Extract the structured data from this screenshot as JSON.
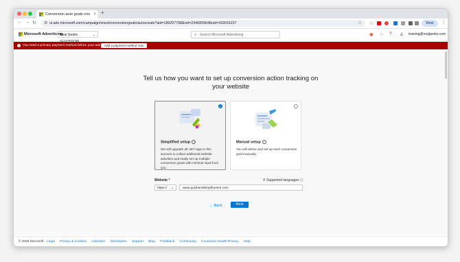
{
  "browser": {
    "tab_title": "Conversion auto goals creati",
    "tab_close": "×",
    "new_tab": "+",
    "url": "ui.ads.microsoft.com/campaign/vnext/conversiongoals/autocreate?aid=189207798&cid=2346839648uid=169016237",
    "profile_label": "Work"
  },
  "app": {
    "brand": "Microsoft Advertising",
    "account_selector": "Real Geeks (G1075SQ8)",
    "search_placeholder": "Search Microsoft Advertising",
    "user_email": "training@realgeeks.com"
  },
  "alert": {
    "message": "You need a primary payment method before your ads will run.",
    "action_label": "Add a payment method now",
    "color": "#a80000"
  },
  "main": {
    "title": "Tell us how you want to set up conversion action tracking on your website",
    "options": [
      {
        "title": "Simplified setup",
        "description": "We will upgrade all UET tags in this account to collect additional website activities and easily set up multiple conversion goals with minimal input from you.",
        "selected": true
      },
      {
        "title": "Manual setup",
        "description": "You will define and set up each conversion goal manually.",
        "selected": false
      }
    ],
    "website_label": "Website",
    "required_mark": "*",
    "supported_languages": "Supported languages",
    "protocol_value": "https://",
    "website_value": "www.quickandsimplhomes.com",
    "back_label": "Back",
    "next_label": "Next",
    "accent_color": "#0078d4"
  },
  "footer": {
    "copyright": "© 2026 Microsoft",
    "links": [
      "Legal",
      "Privacy & Cookies",
      "Advertise",
      "Developers",
      "Support",
      "Blog",
      "Feedback",
      "Community",
      "Consumer Health Privacy",
      "Help"
    ]
  }
}
